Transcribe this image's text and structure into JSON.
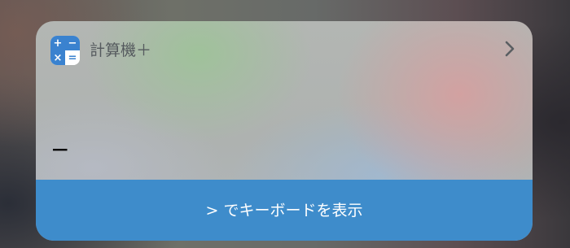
{
  "widget": {
    "app_name": "計算機＋",
    "icon": {
      "name": "calculator-icon",
      "symbols": [
        "+",
        "−",
        "×",
        "="
      ],
      "color": "#3a82cf"
    },
    "chevron_icon": "chevron-right-icon",
    "display_value": "−",
    "action_label": "> でキーボードを表示",
    "colors": {
      "accent": "#3e8ccb",
      "title_text": "#555a5e",
      "display_text": "#000000"
    }
  }
}
